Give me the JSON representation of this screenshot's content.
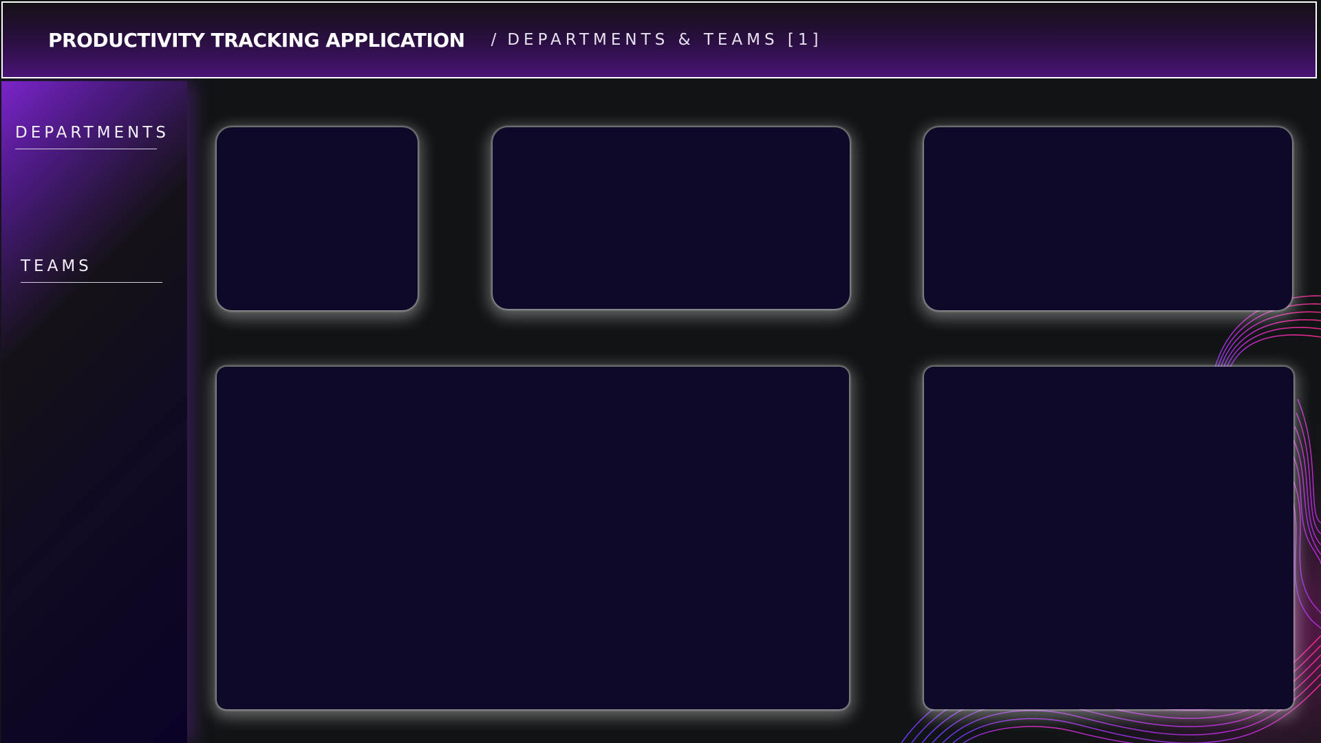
{
  "header": {
    "app_title": "PRODUCTIVITY TRACKING APPLICATION",
    "breadcrumb_separator": "/",
    "breadcrumb_current": "DEPARTMENTS & TEAMS [1]"
  },
  "sidebar": {
    "items": [
      {
        "label": "DEPARTMENTS"
      },
      {
        "label": "TEAMS"
      }
    ]
  },
  "colors": {
    "background": "#111415",
    "card_fill": "#0f0929",
    "accent_purple": "#7a24c9",
    "accent_pink": "#ff2e9a",
    "accent_violet": "#7b4dff"
  }
}
